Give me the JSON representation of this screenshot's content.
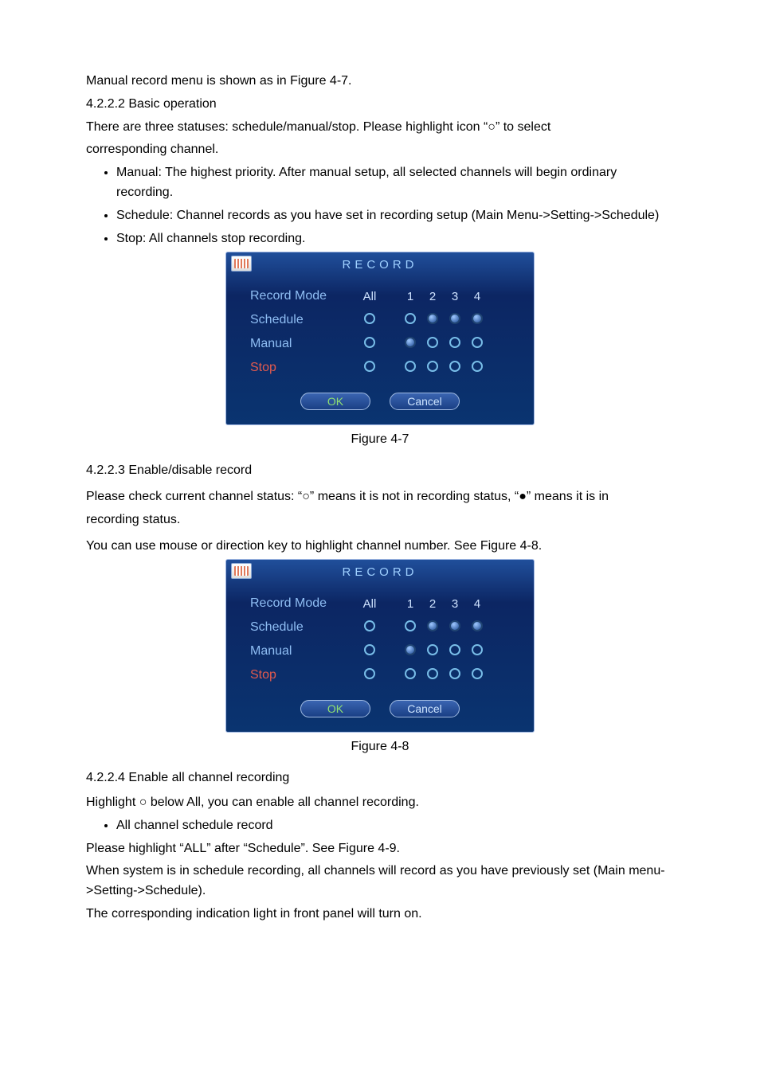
{
  "text": {
    "intro": "Manual record menu is shown as in Figure 4-7.",
    "h1": "4.2.2.2  Basic operation",
    "p1a": "There are three statuses: schedule/manual/stop. Please highlight icon “○”  to select",
    "p1b": "corresponding channel.",
    "b1a": "Manual: The highest priority. After manual setup, all selected channels will begin ordinary recording.",
    "b1b": "Schedule: Channel records as you have set in recording setup (Main Menu->Setting->Schedule)",
    "b1c": "Stop: All channels stop recording.",
    "cap1": "Figure 4-7",
    "h2": "4.2.2.3  Enable/disable record",
    "p2a": "Please check current channel status: “○” means it is not in recording status, “●” means it is in",
    "p2b": "recording status.",
    "p2c": "You can use mouse or direction key to highlight channel number. See Figure 4-8.",
    "cap2": "Figure 4-8",
    "h3": "4.2.2.4  Enable all channel recording",
    "p3a": "Highlight ○ below All, you can enable all channel recording.",
    "b3a": "All channel schedule record",
    "p3b": "Please highlight “ALL” after “Schedule”. See Figure 4-9.",
    "p3c": "When system is in schedule recording, all channels will record as you have previously set (Main menu->Setting->Schedule).",
    "p3d": "The corresponding indication light in front panel will turn on."
  },
  "panel": {
    "title": "RECORD",
    "headers": {
      "mode": "Record Mode",
      "all": "All"
    },
    "channels": [
      "1",
      "2",
      "3",
      "4"
    ],
    "rows": [
      {
        "label": "Schedule",
        "class": "",
        "all": "empty",
        "ch": [
          "empty",
          "filled",
          "filled",
          "filled"
        ]
      },
      {
        "label": "Manual",
        "class": "",
        "all": "empty",
        "ch": [
          "filled",
          "empty",
          "empty",
          "empty"
        ]
      },
      {
        "label": "Stop",
        "class": "stop",
        "all": "empty",
        "ch": [
          "empty",
          "empty",
          "empty",
          "empty"
        ]
      }
    ],
    "ok": "OK",
    "cancel": "Cancel"
  }
}
